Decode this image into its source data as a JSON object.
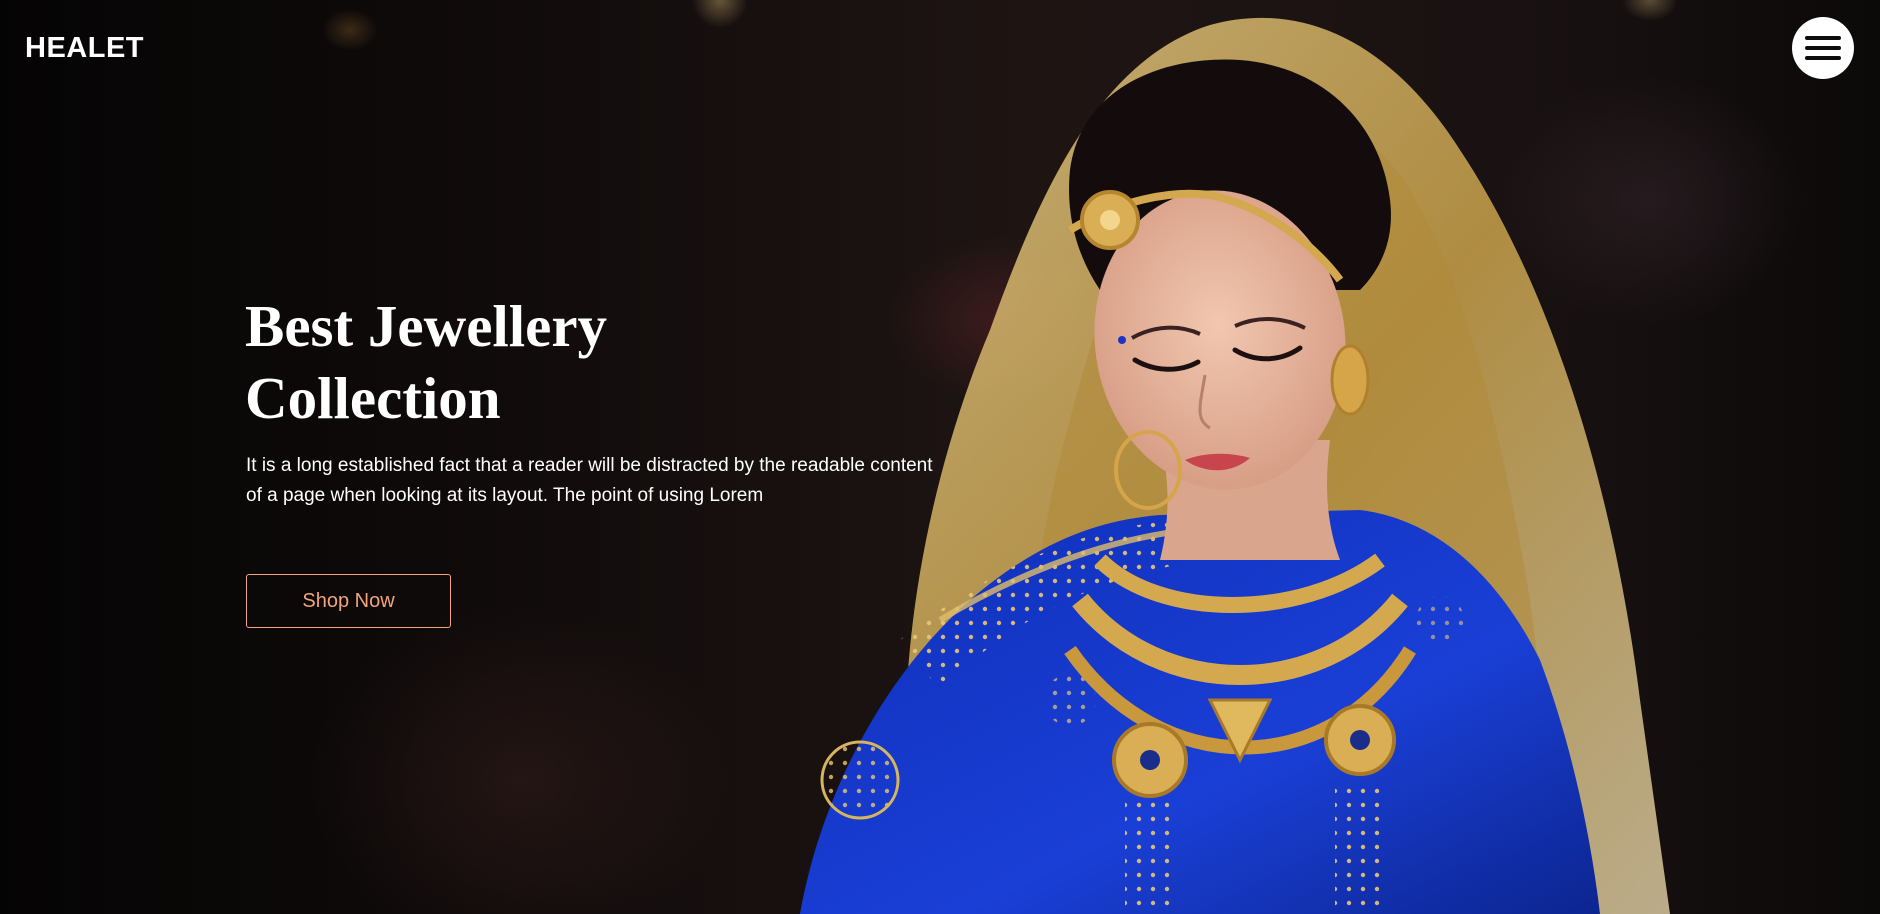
{
  "header": {
    "logo": "HEALET",
    "menu_icon": "hamburger-menu-icon"
  },
  "hero": {
    "title_line1": "Best Jewellery",
    "title_line2": "Collection",
    "description": "It is a long established fact that a reader will be distracted by the readable content of a page when looking at its layout. The point of using Lorem",
    "cta_label": "Shop Now"
  },
  "colors": {
    "text": "#ffffff",
    "accent": "#f2a47a",
    "background": "#0b0808",
    "saree_blue": "#1436c4",
    "gold": "#c9a24a"
  }
}
